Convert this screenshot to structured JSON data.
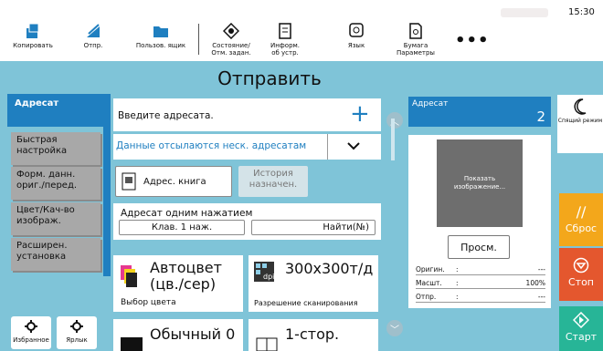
{
  "topbar": {
    "items": [
      {
        "label": "Копировать",
        "icon": "copy-icon"
      },
      {
        "label": "Отпр.",
        "icon": "send-icon"
      },
      {
        "label": "Пользов. ящик",
        "icon": "folder-icon"
      },
      {
        "label": "Состояние/\nОтм. задан.",
        "icon": "status-icon"
      },
      {
        "label": "Информ.\nоб устр.",
        "icon": "device-info-icon"
      },
      {
        "label": "Язык",
        "icon": "language-icon"
      },
      {
        "label": "Бумага\nПараметры",
        "icon": "paper-settings-icon"
      }
    ],
    "more": "•••",
    "clock": "15:30"
  },
  "title": "Отправить",
  "left_tabs": {
    "active": "Адресат",
    "items": [
      "Быстрая\nнастройка",
      "Форм. данн.\nориг./перед.",
      "Цвет/Кач-во\nизображ.",
      "Расширен.\nустановка"
    ]
  },
  "bottom_left": {
    "favorites": "Избранное",
    "shortcut": "Ярлык"
  },
  "main": {
    "enter_destination": "Введите адресата.",
    "multi_send": "Данные отсылаются неск. адресатам",
    "address_book": "Адрес. книга",
    "history": "История\nназначен.",
    "one_touch": "Адресат одним нажатием",
    "key1": "Клав. 1 наж.",
    "find": "Найти(№)",
    "color_value": "Автоцвет\n(цв./сер)",
    "color_caption": "Выбор цвета",
    "resolution_value": "300x300т/д",
    "resolution_caption": "Разрешение сканирования",
    "density_value": "Обычный 0",
    "sides_value": "1-стор."
  },
  "dest_panel": {
    "header": "Адресат",
    "count": "2",
    "preview_text": "Показать\nизображение...",
    "preview_button": "Просм.",
    "rows": [
      {
        "key": "Оригин.",
        "colon": ":",
        "value": "---"
      },
      {
        "key": "Масшт.",
        "colon": ":",
        "value": "100%"
      },
      {
        "key": "Отпр.",
        "colon": ":",
        "value": "---"
      }
    ]
  },
  "actions": {
    "sleep": "Спящий режим",
    "reset": "Сброс",
    "stop": "Стоп",
    "start": "Старт"
  },
  "colors": {
    "background": "#7fc4d8",
    "accent_blue": "#1f7fc0",
    "reset": "#f3a71b",
    "stop": "#e4572e",
    "start": "#27b597"
  }
}
